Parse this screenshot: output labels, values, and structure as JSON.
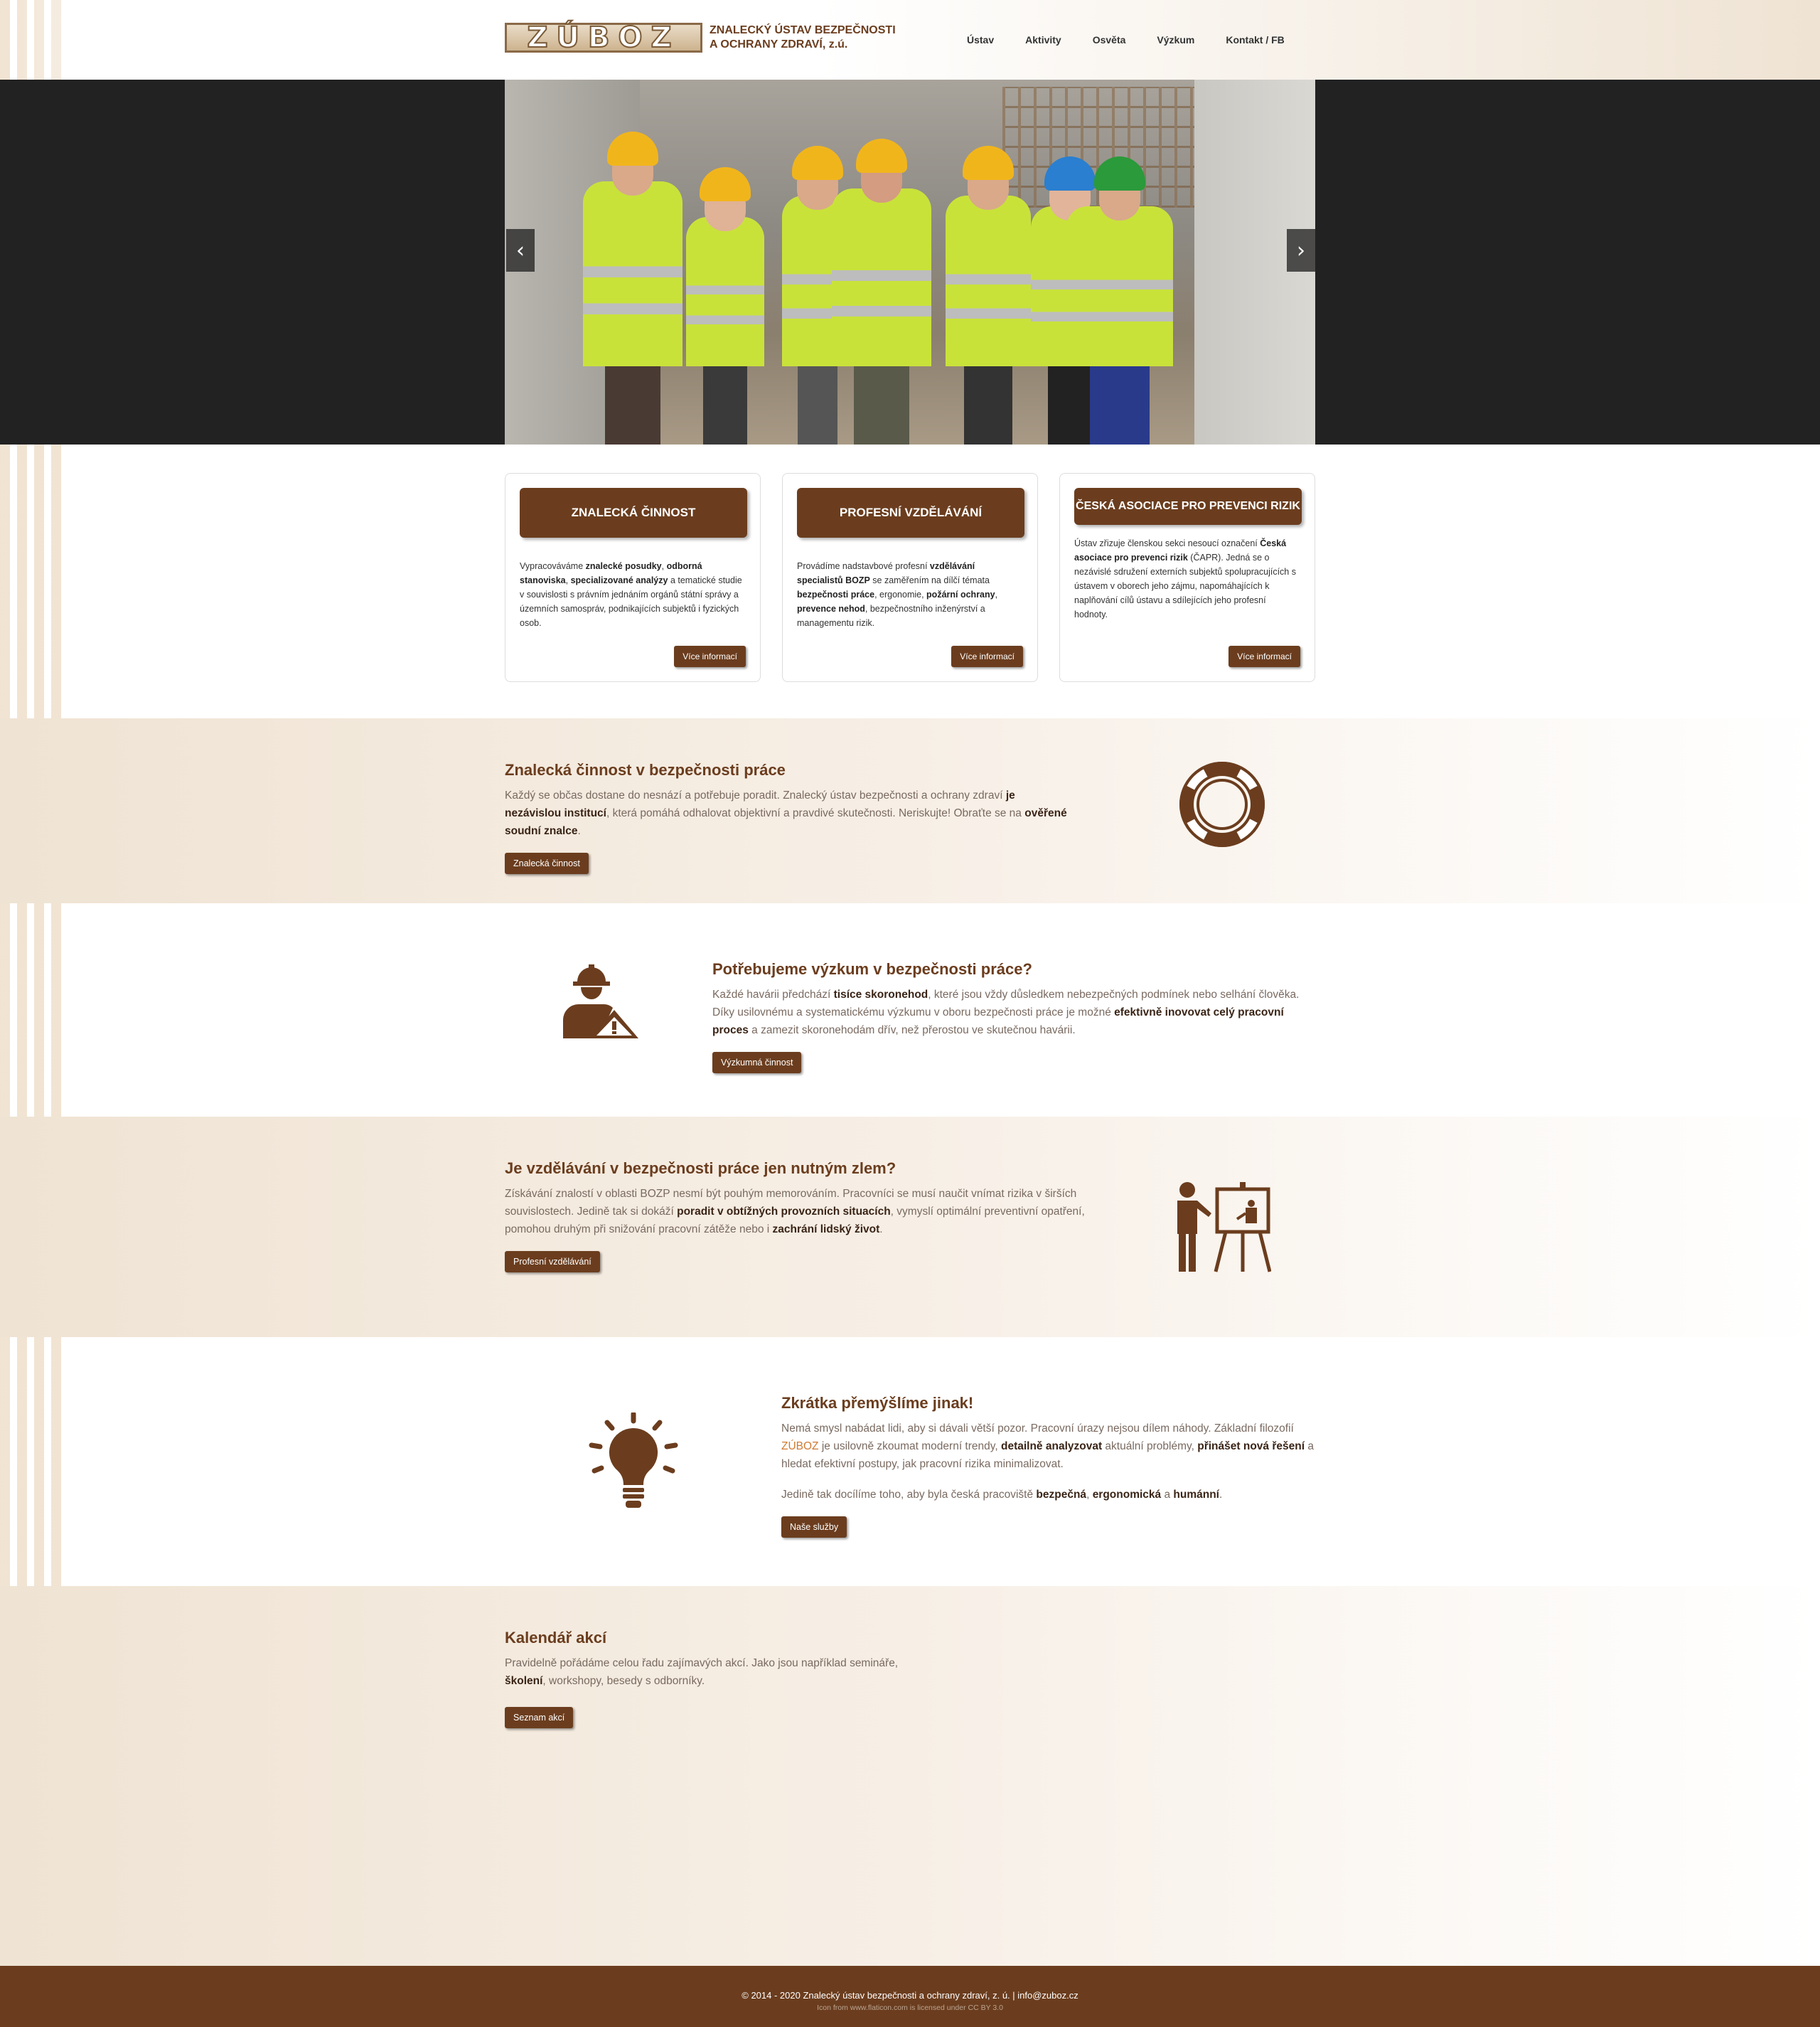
{
  "header": {
    "logo_text": "ZÚBOZ",
    "org_name_line1": "ZNALECKÝ ÚSTAV BEZPEČNOSTI",
    "org_name_line2": "A OCHRANY ZDRAVÍ, z.ú.",
    "nav": [
      "Ústav",
      "Aktivity",
      "Osvěta",
      "Výzkum",
      "Kontakt / FB"
    ]
  },
  "slider": {
    "prev": "‹",
    "next": "›"
  },
  "cards": [
    {
      "title": "ZNALECKÁ ČINNOST",
      "parts": [
        {
          "t": "Vypracováváme "
        },
        {
          "b": "znalecké posudky"
        },
        {
          "t": ", "
        },
        {
          "b": "odborná stanoviska"
        },
        {
          "t": ", "
        },
        {
          "b": "specializované analýzy"
        },
        {
          "t": " a tematické studie v souvislosti s právním jednáním orgánů státní správy a územních samospráv, podnikajících subjektů i fyzických osob."
        }
      ],
      "button": "Více informací"
    },
    {
      "title": "PROFESNÍ VZDĚLÁVÁNÍ",
      "parts": [
        {
          "t": "Provádíme nadstavbové profesní "
        },
        {
          "b": "vzdělávání specialistů BOZP"
        },
        {
          "t": " se zaměřením na dílčí témata "
        },
        {
          "b": "bezpečnosti práce"
        },
        {
          "t": ", ergonomie, "
        },
        {
          "b": "požární ochrany"
        },
        {
          "t": ", "
        },
        {
          "b": "prevence nehod"
        },
        {
          "t": ", bezpečnostního inženýrství a managementu rizik."
        }
      ],
      "button": "Více informací"
    },
    {
      "title": "ČESKÁ ASOCIACE PRO PREVENCI RIZIK",
      "parts": [
        {
          "t": "Ústav zřizuje členskou sekci nesoucí označení "
        },
        {
          "b": "Česká asociace pro prevenci rizik"
        },
        {
          "t": " (ČAPR). Jedná se o nezávislé sdružení externích subjektů spolupracujících s ústavem v oborech jeho zájmu, napomáhajících k naplňování cílů ústavu a sdílejících jeho profesní hodnoty."
        }
      ],
      "button": "Více informací"
    }
  ],
  "sections": [
    {
      "title": "Znalecká činnost v bezpečnosti práce",
      "parts": [
        {
          "t": "Každý se občas dostane do nesnází a potřebuje poradit. Znalecký ústav bezpečnosti a ochrany zdraví "
        },
        {
          "b": "je nezávislou institucí"
        },
        {
          "t": ", která pomáhá odhalovat objektivní a pravdivé skutečnosti. Neriskujte! Obraťte se na "
        },
        {
          "b": "ověřené soudní znalce"
        },
        {
          "t": "."
        }
      ],
      "button": "Znalecká činnost",
      "icon": "lifebuoy-icon"
    },
    {
      "title": "Potřebujeme výzkum v bezpečnosti práce?",
      "parts": [
        {
          "t": "Každé havárii předchází "
        },
        {
          "b": "tisíce skoronehod"
        },
        {
          "t": ", které jsou vždy důsledkem nebezpečných podmínek nebo selhání člověka. Díky usilovnému a systematickému výzkumu v oboru bezpečnosti práce je možné "
        },
        {
          "b": "efektivně inovovat celý pracovní proces"
        },
        {
          "t": " a zamezit skoronehodám dřív, než přerostou ve skutečnou havárii."
        }
      ],
      "button": "Výzkumná činnost",
      "icon": "worker-warning-icon"
    },
    {
      "title": "Je vzdělávání v bezpečnosti práce jen nutným zlem?",
      "parts": [
        {
          "t": "Získávání znalostí v oblasti BOZP nesmí být pouhým memorováním. Pracovníci se musí naučit vnímat rizika v širších souvislostech. Jedině tak si dokáží "
        },
        {
          "b": "poradit v obtížných provozních situacích"
        },
        {
          "t": ", vymyslí optimální preventivní opatření, pomohou druhým při snižování pracovní zátěže nebo i "
        },
        {
          "b": "zachrání lidský život"
        },
        {
          "t": "."
        }
      ],
      "button": "Profesní vzdělávání",
      "icon": "presenter-icon"
    },
    {
      "title": "Zkrátka přemýšlíme jinak!",
      "parts": [
        {
          "t": "Nemá smysl nabádat lidi, aby si dávali větší pozor. Pracovní úrazy nejsou dílem náhody. Základní filozofií "
        },
        {
          "h": "ZÚBOZ"
        },
        {
          "t": " je usilovně zkoumat moderní trendy, "
        },
        {
          "b": "detailně analyzovat"
        },
        {
          "t": " aktuální problémy, "
        },
        {
          "b": "přinášet nová řešení"
        },
        {
          "t": " a hledat efektivní postupy, jak pracovní rizika minimalizovat."
        }
      ],
      "parts2": [
        {
          "t": "Jedině tak docílíme toho, aby byla česká pracoviště "
        },
        {
          "b": "bezpečná"
        },
        {
          "t": ", "
        },
        {
          "b": "ergonomická"
        },
        {
          "t": " a "
        },
        {
          "b": "humánní"
        },
        {
          "t": "."
        }
      ],
      "button": "Naše služby",
      "icon": "lightbulb-icon"
    },
    {
      "title": "Kalendář akcí",
      "parts": [
        {
          "t": "Pravidelně pořádáme celou řadu zajímavých akcí. Jako jsou například semináře, "
        },
        {
          "b": "školení"
        },
        {
          "t": ", workshopy, besedy s odborníky."
        }
      ],
      "button": "Seznam akcí"
    }
  ],
  "footer": {
    "line1": "© 2014 - 2020 Znalecký ústav bezpečnosti a ochrany zdraví, z. ú. | info@zuboz.cz",
    "line2": "Icon from www.flaticon.com is licensed under CC BY 3.0"
  },
  "colors": {
    "brand": "#6b3d1e",
    "beige": "#efe3d3",
    "footer": "#6b3d1e",
    "highlight": "#d07a30"
  }
}
